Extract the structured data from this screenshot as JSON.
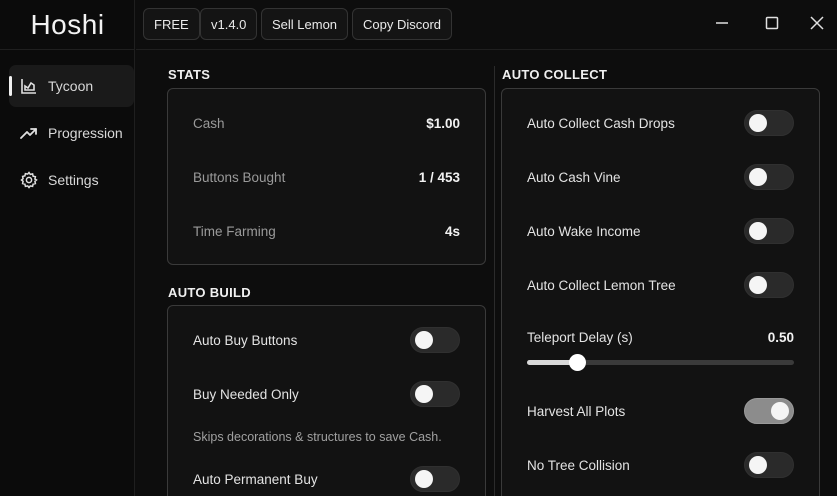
{
  "app": {
    "title": "Hoshi"
  },
  "sidebar": {
    "items": [
      {
        "label": "Tycoon",
        "icon": "chart-icon",
        "active": true
      },
      {
        "label": "Progression",
        "icon": "trend-up-icon",
        "active": false
      },
      {
        "label": "Settings",
        "icon": "gear-icon",
        "active": false
      }
    ]
  },
  "topbar": {
    "buttons": [
      {
        "label": "FREE"
      },
      {
        "label": "v1.4.0"
      },
      {
        "label": "Sell Lemon"
      },
      {
        "label": "Copy Discord"
      }
    ],
    "window_controls": [
      "minimize-icon",
      "maximize-icon",
      "close-icon"
    ]
  },
  "stats": {
    "title": "STATS",
    "rows": [
      {
        "label": "Cash",
        "value": "$1.00"
      },
      {
        "label": "Buttons Bought",
        "value": "1 / 453"
      },
      {
        "label": "Time Farming",
        "value": "4s"
      }
    ]
  },
  "auto_build": {
    "title": "AUTO BUILD",
    "toggles": [
      {
        "label": "Auto Buy Buttons",
        "on": false
      },
      {
        "label": "Buy Needed Only",
        "on": false
      },
      {
        "label": "Auto Permanent Buy",
        "on": false
      }
    ],
    "note": "Skips decorations & structures to save Cash."
  },
  "auto_collect": {
    "title": "AUTO COLLECT",
    "toggles": [
      {
        "label": "Auto Collect Cash Drops",
        "on": false
      },
      {
        "label": "Auto Cash Vine",
        "on": false
      },
      {
        "label": "Auto Wake Income",
        "on": false
      },
      {
        "label": "Auto Collect Lemon Tree",
        "on": false
      }
    ],
    "slider": {
      "label": "Teleport Delay (s)",
      "value": "0.50",
      "fraction": 0.19
    },
    "toggles2": [
      {
        "label": "Harvest All Plots",
        "on": true
      },
      {
        "label": "No Tree Collision",
        "on": false
      }
    ]
  }
}
